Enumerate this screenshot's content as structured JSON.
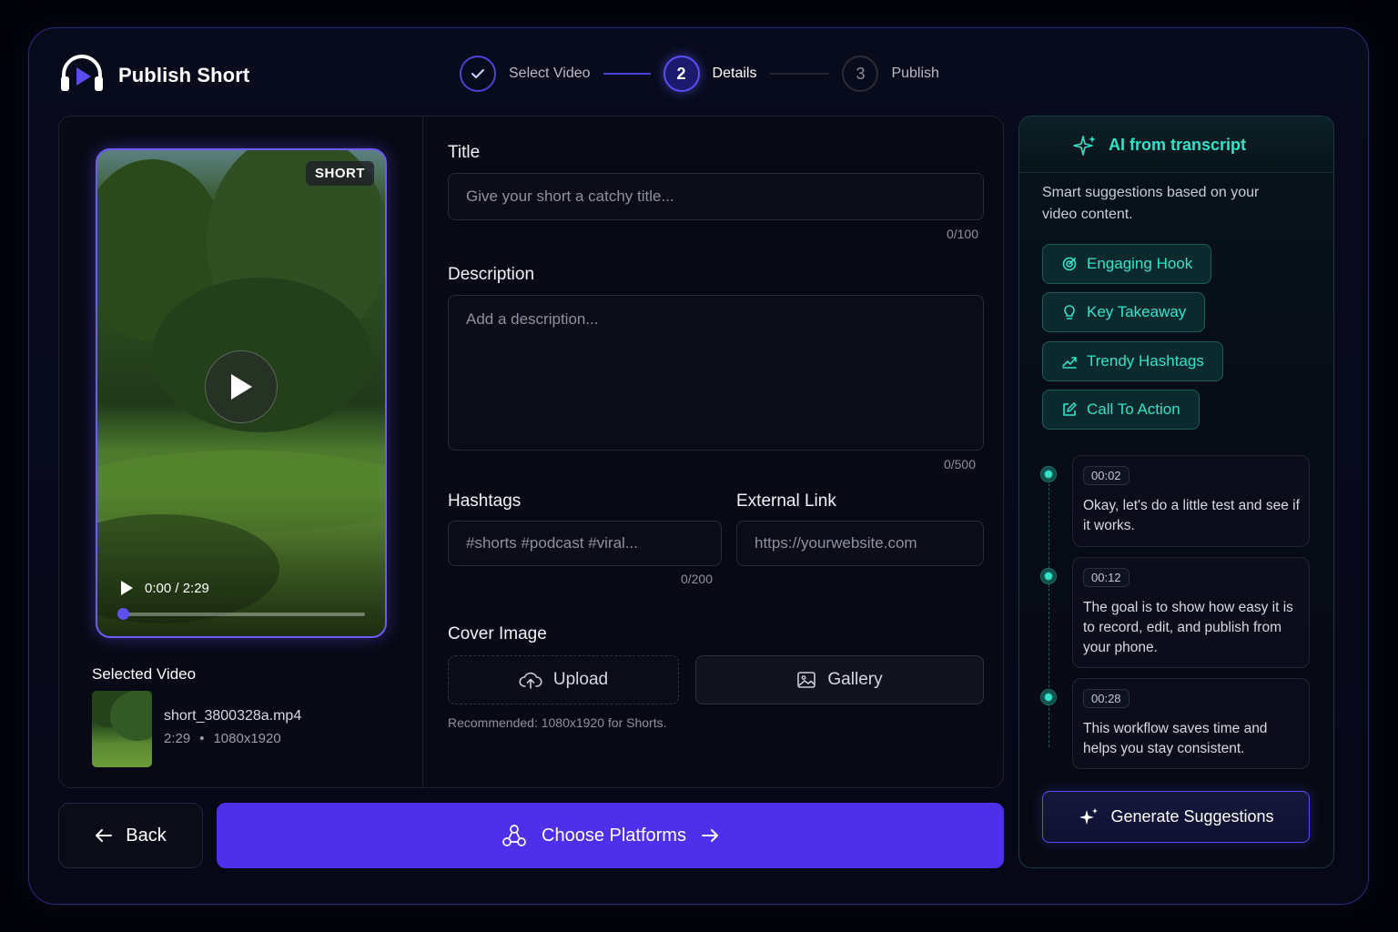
{
  "app": {
    "title": "Publish Short"
  },
  "stepper": {
    "steps": [
      {
        "label": "Select Video",
        "number": "",
        "state": "done"
      },
      {
        "label": "Details",
        "number": "2",
        "state": "active"
      },
      {
        "label": "Publish",
        "number": "3",
        "state": "idle"
      }
    ]
  },
  "video": {
    "badge": "SHORT",
    "time": "0:00 / 2:29",
    "progress": 0
  },
  "selected": {
    "title": "Selected Video",
    "file_name": "short_3800328a.mp4",
    "duration": "2:29",
    "resolution": "1080x1920"
  },
  "form": {
    "title": {
      "label": "Title",
      "placeholder": "Give your short a catchy title...",
      "counter": "0/100"
    },
    "description": {
      "label": "Description",
      "placeholder": "Add a description...",
      "counter": "0/500"
    },
    "hashtags": {
      "label": "Hashtags",
      "placeholder": "#shorts #podcast #viral...",
      "counter": "0/200"
    },
    "external_link": {
      "label": "External Link",
      "placeholder": "https://yourwebsite.com"
    },
    "cover": {
      "label": "Cover Image",
      "upload_label": "Upload",
      "gallery_label": "Gallery",
      "hint": "Recommended: 1080x1920 for Shorts."
    }
  },
  "footer": {
    "back_label": "Back",
    "primary_label": "Choose Platforms"
  },
  "ai": {
    "title": "AI from transcript",
    "description": "Smart suggestions based on your video content.",
    "chips": [
      {
        "label": "Engaging Hook",
        "icon": "target-icon"
      },
      {
        "label": "Key Takeaway",
        "icon": "lightbulb-icon"
      },
      {
        "label": "Trendy Hashtags",
        "icon": "trending-icon"
      },
      {
        "label": "Call To Action",
        "icon": "edit-icon"
      }
    ],
    "transcript": [
      {
        "time": "00:02",
        "text": "Okay, let's do a little test and see if it works."
      },
      {
        "time": "00:12",
        "text": "The goal is to show how easy it is to record, edit, and publish from your phone."
      },
      {
        "time": "00:28",
        "text": "This workflow saves time and helps you stay consistent."
      }
    ],
    "generate_label": "Generate Suggestions"
  },
  "colors": {
    "accent": "#4f30ea",
    "ai_accent": "#31e3c8",
    "background": "#020308"
  }
}
